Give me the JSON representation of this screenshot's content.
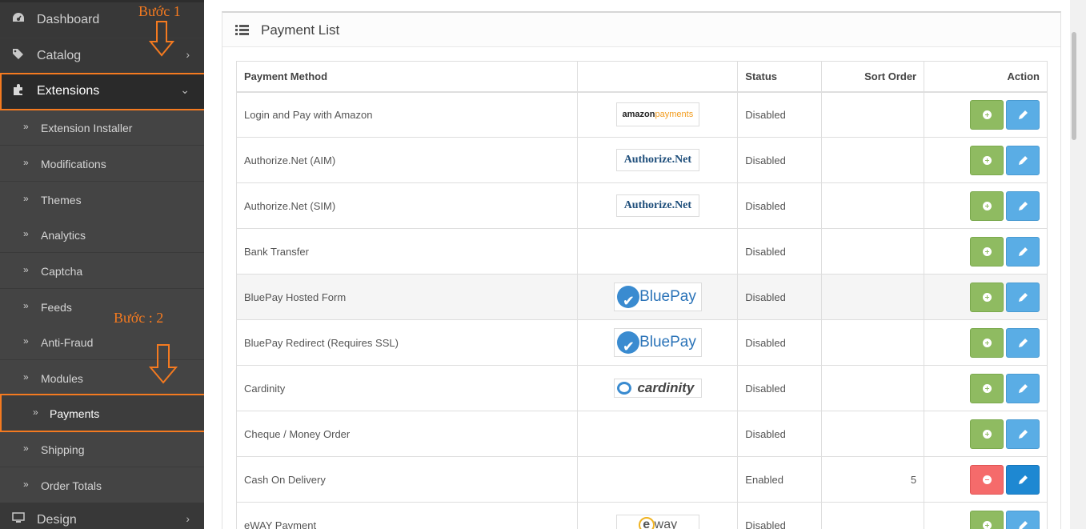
{
  "sidebar": {
    "menu": [
      {
        "label": "Dashboard",
        "icon": "dashboard-icon"
      },
      {
        "label": "Catalog",
        "icon": "tags-icon"
      },
      {
        "label": "Extensions",
        "icon": "puzzle-icon"
      },
      {
        "label": "Design",
        "icon": "monitor-icon"
      }
    ],
    "extensions_sub": [
      "Extension Installer",
      "Modifications",
      "Themes",
      "Analytics",
      "Captcha",
      "Feeds",
      "Anti-Fraud",
      "Modules",
      "Payments",
      "Shipping",
      "Order Totals"
    ]
  },
  "annotations": {
    "step1": "Bước 1",
    "step2": "Bước : 2",
    "color": "#f47a20"
  },
  "panel": {
    "title": "Payment List"
  },
  "table": {
    "headers": {
      "method": "Payment Method",
      "logo": "",
      "status": "Status",
      "sort": "Sort Order",
      "action": "Action"
    },
    "rows": [
      {
        "method": "Login and Pay with Amazon",
        "logo": "amazonpayments",
        "status": "Disabled",
        "sort": "",
        "installed": false
      },
      {
        "method": "Authorize.Net (AIM)",
        "logo": "Authorize.Net",
        "status": "Disabled",
        "sort": "",
        "installed": false
      },
      {
        "method": "Authorize.Net (SIM)",
        "logo": "Authorize.Net",
        "status": "Disabled",
        "sort": "",
        "installed": false
      },
      {
        "method": "Bank Transfer",
        "logo": "",
        "status": "Disabled",
        "sort": "",
        "installed": false
      },
      {
        "method": "BluePay Hosted Form",
        "logo": "BluePay",
        "status": "Disabled",
        "sort": "",
        "installed": false
      },
      {
        "method": "BluePay Redirect (Requires SSL)",
        "logo": "BluePay",
        "status": "Disabled",
        "sort": "",
        "installed": false
      },
      {
        "method": "Cardinity",
        "logo": "cardinity",
        "status": "Disabled",
        "sort": "",
        "installed": false
      },
      {
        "method": "Cheque / Money Order",
        "logo": "",
        "status": "Disabled",
        "sort": "",
        "installed": false
      },
      {
        "method": "Cash On Delivery",
        "logo": "",
        "status": "Enabled",
        "sort": "5",
        "installed": true
      },
      {
        "method": "eWAY Payment",
        "logo": "eway",
        "status": "Disabled",
        "sort": "",
        "installed": false
      }
    ]
  },
  "colors": {
    "sidebar_bg": "#383838",
    "add_button": "#8fbb61",
    "remove_button": "#f56b6b",
    "edit_button": "#5aade5"
  }
}
